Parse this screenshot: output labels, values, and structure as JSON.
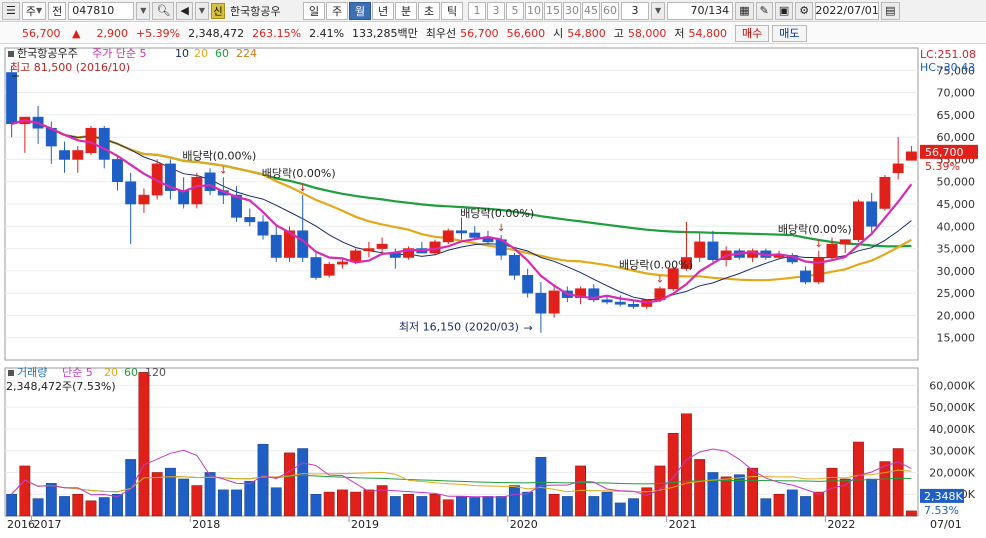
{
  "toolbar": {
    "market": "주",
    "type": "전",
    "code": "047810",
    "sin": "신",
    "stock_name": "한국항공우",
    "periods": [
      "일",
      "주",
      "월",
      "년",
      "분",
      "초",
      "틱"
    ],
    "selected_period": "월",
    "numbers": [
      "1",
      "3",
      "5",
      "10",
      "15",
      "30",
      "45",
      "60"
    ],
    "count_select": "3",
    "count": "70/134",
    "date": "2022/07/01"
  },
  "info": {
    "price": "56,700",
    "price_arrow": "▲",
    "change": "2,900",
    "change_pct": "+5.39%",
    "volume": "2,348,472",
    "volume_ratio": "263.15%",
    "turnover": "2.41%",
    "amount": "133,285백만",
    "best_label": "최우선",
    "best_ask": "56,700",
    "best_bid": "56,600",
    "open_label": "시",
    "open": "54,800",
    "high_label": "고",
    "high": "58,000",
    "low_label": "저",
    "low": "54,800",
    "buy": "매수",
    "sell": "매도"
  },
  "chart_data": [
    {
      "type": "candlestick",
      "title": "한국항공우주",
      "legend": [
        "주가 단순 5",
        "10",
        "20",
        "60",
        "224"
      ],
      "legend_colors": [
        "#d62bb2",
        "#1a2b6b",
        "#e3a81c",
        "#1e9e3c",
        "#d07a10"
      ],
      "ylim": [
        10000,
        80000
      ],
      "yticks": [
        "75,000",
        "70,000",
        "65,000",
        "60,000",
        "55,000",
        "50,000",
        "45,000",
        "40,000",
        "35,000",
        "30,000",
        "25,000",
        "20,000",
        "15,000"
      ],
      "right_labels": {
        "lc": "LC:251.08",
        "hc": "HC:-30.43",
        "last": "56,700",
        "last_pct": "5.39%"
      },
      "annotations": {
        "high": "최고 81,500 (2016/10)",
        "low": "최저 16,150 (2020/03)",
        "dividend": "배당락(0.00%)"
      },
      "candles": [
        [
          74500,
          76000,
          60000,
          63000
        ],
        [
          63000,
          64000,
          56500,
          64500
        ],
        [
          64500,
          67000,
          58500,
          62000
        ],
        [
          62000,
          63500,
          54000,
          58000
        ],
        [
          57000,
          59000,
          52000,
          55000
        ],
        [
          55000,
          58000,
          52000,
          57000
        ],
        [
          56500,
          62500,
          56000,
          62000
        ],
        [
          62000,
          62500,
          53000,
          55000
        ],
        [
          55000,
          56000,
          48000,
          50000
        ],
        [
          50000,
          52000,
          36000,
          45000
        ],
        [
          45000,
          48500,
          43000,
          47000
        ],
        [
          47000,
          55000,
          46000,
          54000
        ],
        [
          54000,
          55000,
          46000,
          48000
        ],
        [
          48000,
          51000,
          44000,
          45000
        ],
        [
          45000,
          52000,
          44000,
          51000
        ],
        [
          52000,
          53000,
          47000,
          48000
        ],
        [
          48000,
          51000,
          45000,
          47000
        ],
        [
          47000,
          49000,
          41000,
          42000
        ],
        [
          42000,
          44000,
          40000,
          41000
        ],
        [
          41000,
          42500,
          37000,
          38000
        ],
        [
          38000,
          40000,
          32000,
          33000
        ],
        [
          33000,
          40000,
          32000,
          39000
        ],
        [
          39000,
          47000,
          32000,
          33000
        ],
        [
          33000,
          34500,
          28000,
          28500
        ],
        [
          29000,
          32000,
          28500,
          31500
        ],
        [
          31500,
          33000,
          30500,
          32000
        ],
        [
          32000,
          35000,
          31500,
          34500
        ],
        [
          34500,
          36500,
          33000,
          35000
        ],
        [
          35000,
          37500,
          34000,
          36000
        ],
        [
          34000,
          35000,
          30500,
          33000
        ],
        [
          33000,
          35500,
          32500,
          35000
        ],
        [
          35000,
          36500,
          34000,
          34000
        ],
        [
          34000,
          37000,
          33500,
          36500
        ],
        [
          36500,
          39500,
          36000,
          39000
        ],
        [
          39000,
          42000,
          37000,
          38500
        ],
        [
          38500,
          40000,
          37000,
          37500
        ],
        [
          37500,
          39000,
          36000,
          36500
        ],
        [
          37000,
          38000,
          32500,
          33500
        ],
        [
          33500,
          34000,
          28000,
          29000
        ],
        [
          29000,
          30500,
          24000,
          25000
        ],
        [
          25000,
          27500,
          16150,
          20500
        ],
        [
          20500,
          27000,
          19500,
          25500
        ],
        [
          25500,
          26500,
          23000,
          24000
        ],
        [
          24000,
          26500,
          22500,
          26000
        ],
        [
          26000,
          27000,
          23000,
          23500
        ],
        [
          23500,
          24500,
          22500,
          23000
        ],
        [
          23000,
          24500,
          22000,
          22500
        ],
        [
          22500,
          23500,
          21500,
          22000
        ],
        [
          22000,
          23500,
          21500,
          23500
        ],
        [
          23500,
          26500,
          23000,
          26000
        ],
        [
          26000,
          31000,
          25500,
          30500
        ],
        [
          30500,
          41000,
          30000,
          33000
        ],
        [
          33000,
          38500,
          32000,
          36500
        ],
        [
          36500,
          39000,
          32000,
          32500
        ],
        [
          32500,
          35500,
          31000,
          34500
        ],
        [
          34500,
          35000,
          32500,
          33000
        ],
        [
          33000,
          35000,
          32000,
          34500
        ],
        [
          34500,
          35000,
          32500,
          33000
        ],
        [
          33000,
          34500,
          32500,
          33500
        ],
        [
          33500,
          34000,
          31500,
          32000
        ],
        [
          30000,
          31000,
          27000,
          27500
        ],
        [
          27500,
          34500,
          27000,
          33000
        ],
        [
          33000,
          37500,
          32500,
          36000
        ],
        [
          36000,
          37000,
          34000,
          37000
        ],
        [
          37000,
          46000,
          36500,
          45500
        ],
        [
          45500,
          47500,
          38500,
          40000
        ],
        [
          44000,
          51500,
          43500,
          51000
        ],
        [
          52000,
          60000,
          50500,
          54000
        ],
        [
          54800,
          58000,
          54800,
          56700
        ]
      ],
      "xlabels": [
        "2016",
        "2017",
        "2018",
        "2019",
        "2020",
        "2021",
        "2022",
        "07/01"
      ],
      "dividend_markers": [
        16,
        22,
        37,
        49,
        61
      ]
    },
    {
      "type": "bar",
      "title": "거래량",
      "legend": [
        "단순 5",
        "20",
        "60",
        "120"
      ],
      "legend_colors": [
        "#c23ac7",
        "#e3a81c",
        "#1e9e3c",
        "#555555"
      ],
      "summary": "2,348,472주(7.53%)",
      "ylim": [
        0,
        68000
      ],
      "yticks": [
        "60,000K",
        "50,000K",
        "40,000K",
        "30,000K",
        "20,000K",
        "10,000K"
      ],
      "right_labels": {
        "last": "2,348K",
        "last_pct": "7.53%"
      },
      "volume": [
        10000,
        23000,
        8000,
        15000,
        9000,
        10000,
        7000,
        8500,
        10000,
        26000,
        66000,
        20000,
        22000,
        17000,
        14000,
        20000,
        12000,
        12000,
        16000,
        33000,
        13000,
        29000,
        31000,
        10000,
        11000,
        12000,
        11000,
        12000,
        14000,
        9000,
        10000,
        9000,
        10000,
        7500,
        9000,
        8500,
        9000,
        9000,
        14000,
        11000,
        27000,
        10000,
        9000,
        23000,
        9000,
        11000,
        6000,
        8000,
        13000,
        23000,
        38000,
        47000,
        26000,
        20000,
        18000,
        19000,
        22000,
        8000,
        10000,
        12000,
        9000,
        11000,
        22000,
        17000,
        34000,
        17000,
        25000,
        31000,
        2348
      ]
    }
  ]
}
